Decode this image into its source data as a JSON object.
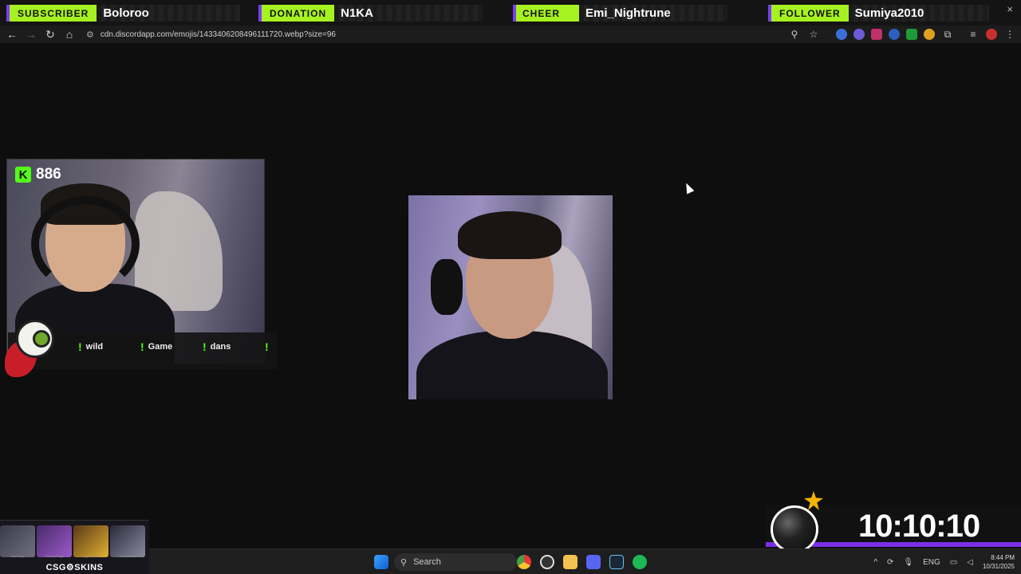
{
  "alerts": [
    {
      "type": "SUBSCRIBER",
      "name": "Boloroo"
    },
    {
      "type": "DONATION",
      "name": "N1KA"
    },
    {
      "type": "CHEER",
      "name": "Emi_Nightrune"
    },
    {
      "type": "FOLLOWER",
      "name": "Sumiya2010"
    }
  ],
  "alert_close": "×",
  "browser": {
    "url": "cdn.discordapp.com/emojis/1433406208496111720.webp?size=96",
    "back": "←",
    "forward": "→",
    "reload": "↻",
    "home": "⌂"
  },
  "stream": {
    "follower_count": "886",
    "kick_logo": "K",
    "commands": [
      "wild",
      "Game",
      "dans",
      ""
    ]
  },
  "skins_widget": {
    "brand": "CSG⚙SKINS",
    "items": [
      "Bad Sky",
      "Toxicity Bugs",
      "Tiger Tooth",
      "Printstream"
    ]
  },
  "timer": "10:10:10",
  "taskbar": {
    "search_placeholder": "Search",
    "language": "ENG",
    "time": "8:44 PM",
    "date": "10/31/2025"
  },
  "colors": {
    "accent_green": "#a6f220",
    "kick_green": "#53fc18",
    "purple": "#7a2ee8"
  }
}
